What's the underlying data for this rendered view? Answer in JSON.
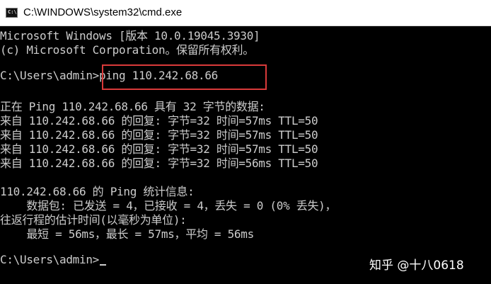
{
  "window": {
    "title": "C:\\WINDOWS\\system32\\cmd.exe",
    "icon": "cmd-icon"
  },
  "console": {
    "lines": [
      "Microsoft Windows [版本 10.0.19045.3930]",
      "(c) Microsoft Corporation。保留所有权利。",
      "",
      "C:\\Users\\admin>ping 110.242.68.66",
      "",
      "正在 Ping 110.242.68.66 具有 32 字节的数据:",
      "来自 110.242.68.66 的回复: 字节=32 时间=57ms TTL=50",
      "来自 110.242.68.66 的回复: 字节=32 时间=57ms TTL=50",
      "来自 110.242.68.66 的回复: 字节=32 时间=57ms TTL=50",
      "来自 110.242.68.66 的回复: 字节=32 时间=56ms TTL=50",
      "",
      "110.242.68.66 的 Ping 统计信息:",
      "    数据包: 已发送 = 4，已接收 = 4，丢失 = 0 (0% 丢失)，",
      "往返行程的估计时间(以毫秒为单位):",
      "    最短 = 56ms，最长 = 57ms，平均 = 56ms",
      "",
      "C:\\Users\\admin>"
    ]
  },
  "watermark": "知乎 @十八0618",
  "colors": {
    "console_bg": "#000000",
    "console_text": "#cccccc",
    "highlight": "#d93a3a"
  }
}
